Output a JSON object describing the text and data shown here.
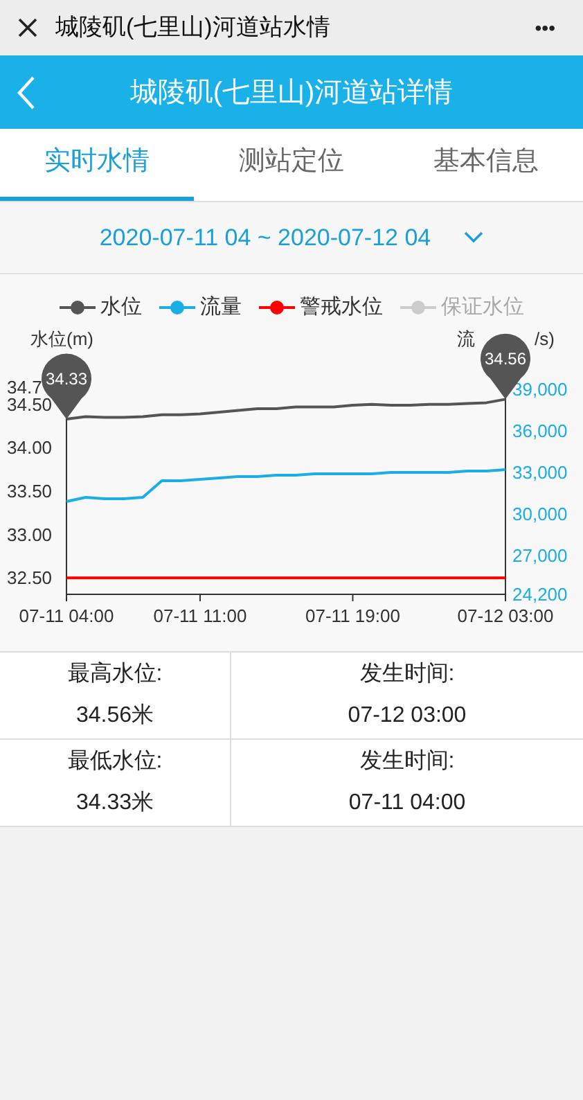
{
  "top_bar": {
    "title": "城陵矶(七里山)河道站水情",
    "more": "•••"
  },
  "header": {
    "title": "城陵矶(七里山)河道站详情"
  },
  "tabs": [
    {
      "label": "实时水情",
      "selected": true
    },
    {
      "label": "测站定位",
      "selected": false
    },
    {
      "label": "基本信息",
      "selected": false
    }
  ],
  "date_range": {
    "text": "2020-07-11 04 ~ 2020-07-12 04"
  },
  "chart": {
    "right_axis_title_parts": [
      "流",
      "/s)"
    ],
    "legend": [
      {
        "selected": true
      },
      {
        "selected": true
      },
      {
        "selected": true
      },
      {
        "selected": false
      }
    ],
    "chart_data": {
      "type": "line",
      "ylabel": "水位(m)",
      "legend": true,
      "categories": [
        "07-11 04:00",
        null,
        null,
        null,
        null,
        null,
        null,
        "07-11 11:00",
        null,
        null,
        null,
        null,
        null,
        null,
        null,
        "07-11 19:00",
        null,
        null,
        null,
        null,
        null,
        null,
        null,
        "07-12 03:00"
      ],
      "ylim": [
        32.23,
        34.85
      ],
      "yticks": [
        {
          "value": 32.5,
          "label": "32.50"
        },
        {
          "value": 33,
          "label": "33.00"
        },
        {
          "value": 33.5,
          "label": "33.50"
        },
        {
          "value": 34,
          "label": "34.00"
        },
        {
          "value": 34.5,
          "label": "34.50"
        },
        {
          "value": 34.7,
          "label": "34.7"
        }
      ],
      "y2lim": [
        23700,
        40100
      ],
      "y2ticks": [
        {
          "value": 24200,
          "label": "24,200"
        },
        {
          "value": 27000,
          "label": "27,000"
        },
        {
          "value": 30000,
          "label": "30,000"
        },
        {
          "value": 33000,
          "label": "33,000"
        },
        {
          "value": 36000,
          "label": "36,000"
        },
        {
          "value": 39000,
          "label": "39,000"
        }
      ],
      "series": [
        {
          "name": "水位",
          "color": "#555555",
          "values": [
            34.33,
            34.36,
            34.35,
            34.35,
            34.36,
            34.38,
            34.38,
            34.39,
            34.41,
            34.43,
            34.45,
            34.45,
            34.47,
            34.47,
            34.47,
            34.49,
            34.5,
            34.49,
            34.49,
            34.5,
            34.5,
            34.51,
            34.52,
            34.56
          ]
        },
        {
          "name": "流量",
          "color": "#1aaee5",
          "axis": "y2",
          "values": [
            30900,
            31200,
            31100,
            31100,
            31200,
            32400,
            32400,
            32500,
            32600,
            32700,
            32700,
            32800,
            32800,
            32900,
            32900,
            32900,
            32900,
            33000,
            33000,
            33000,
            33000,
            33100,
            33100,
            33200
          ]
        },
        {
          "name": "警戒水位",
          "color": "#ff0000",
          "values": [
            32.5,
            32.5,
            32.5,
            32.5,
            32.5,
            32.5,
            32.5,
            32.5,
            32.5,
            32.5,
            32.5,
            32.5,
            32.5,
            32.5,
            32.5,
            32.5,
            32.5,
            32.5,
            32.5,
            32.5,
            32.5,
            32.5,
            32.5,
            32.5
          ]
        },
        {
          "name": "保证水位",
          "color": "#cccccc",
          "values": [
            null,
            null,
            null,
            null,
            null,
            null,
            null,
            null,
            null,
            null,
            null,
            null,
            null,
            null,
            null,
            null,
            null,
            null,
            null,
            null,
            null,
            null,
            null,
            null
          ]
        }
      ],
      "annotations": [
        "34.33",
        "34.56"
      ]
    }
  },
  "stats": [
    {
      "label": "最高水位:",
      "value": "34.56米",
      "time_label": "发生时间:",
      "time": "07-12 03:00"
    },
    {
      "label": "最低水位:",
      "value": "34.33米",
      "time_label": "发生时间:",
      "time": "07-11 04:00"
    }
  ]
}
